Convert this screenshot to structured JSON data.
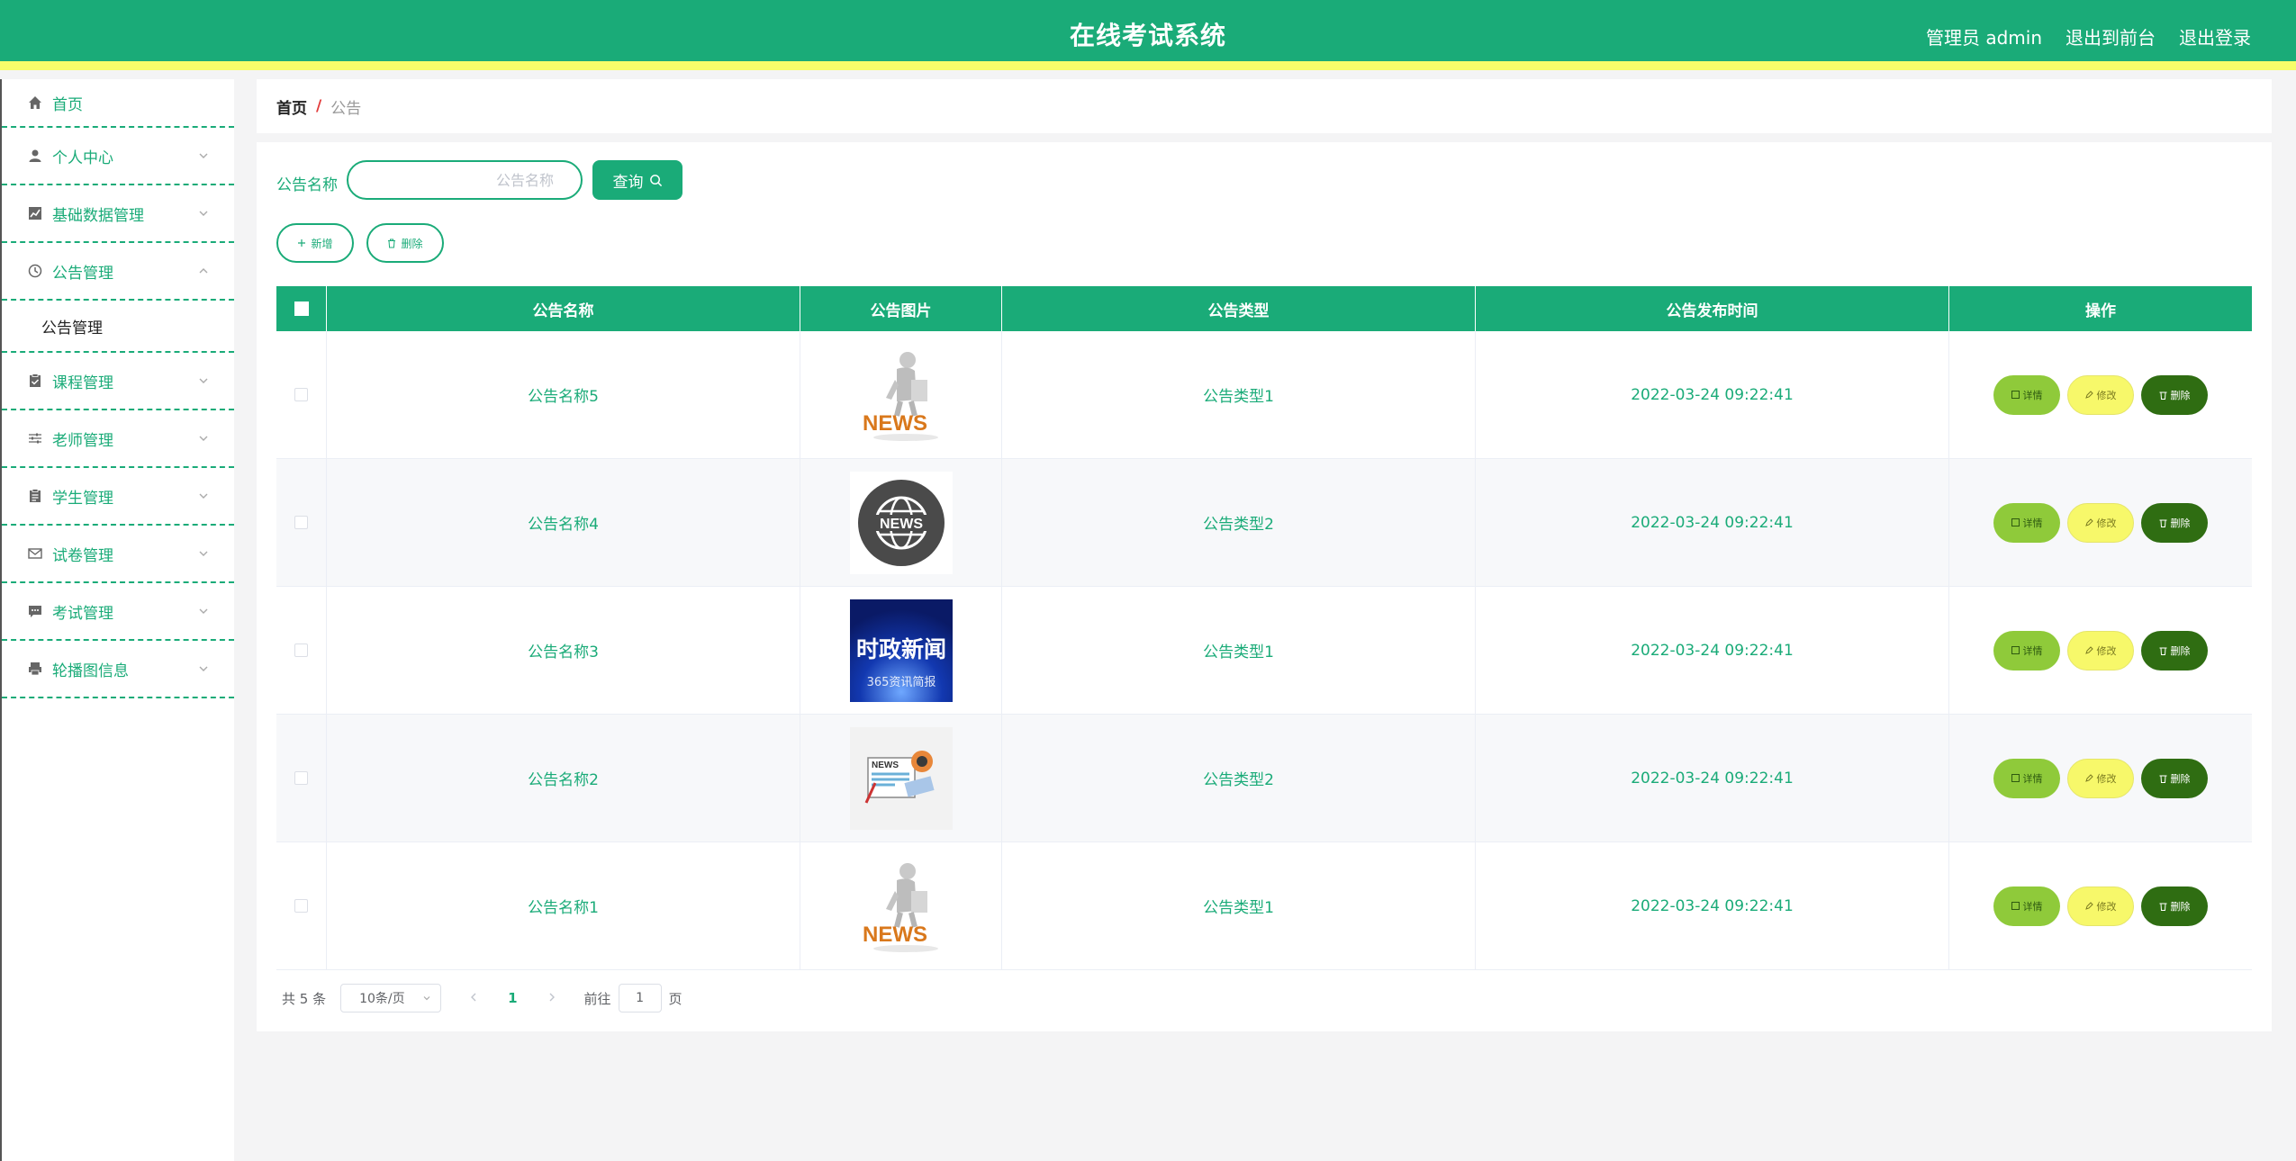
{
  "header": {
    "title": "在线考试系统",
    "admin": "管理员 admin",
    "to_front": "退出到前台",
    "logout": "退出登录"
  },
  "sidebar": {
    "items": [
      {
        "label": "首页",
        "icon": "home-icon"
      },
      {
        "label": "个人中心",
        "icon": "user-icon"
      },
      {
        "label": "基础数据管理",
        "icon": "chart-icon"
      },
      {
        "label": "公告管理",
        "icon": "clock-icon"
      },
      {
        "label": "课程管理",
        "icon": "clipboard-icon"
      },
      {
        "label": "老师管理",
        "icon": "sliders-icon"
      },
      {
        "label": "学生管理",
        "icon": "document-icon"
      },
      {
        "label": "试卷管理",
        "icon": "mail-icon"
      },
      {
        "label": "考试管理",
        "icon": "chat-icon"
      },
      {
        "label": "轮播图信息",
        "icon": "printer-icon"
      }
    ],
    "submenu": "公告管理"
  },
  "breadcrumb": {
    "home": "首页",
    "sep": "/",
    "current": "公告"
  },
  "search": {
    "label": "公告名称",
    "placeholder": "公告名称",
    "query": "查询"
  },
  "actions": {
    "add": "新增",
    "delete": "删除"
  },
  "table": {
    "headers": [
      "公告名称",
      "公告图片",
      "公告类型",
      "公告发布时间",
      "操作"
    ],
    "rows": [
      {
        "name": "公告名称5",
        "image": "news-figure",
        "type": "公告类型1",
        "time": "2022-03-24 09:22:41"
      },
      {
        "name": "公告名称4",
        "image": "news-globe",
        "type": "公告类型2",
        "time": "2022-03-24 09:22:41"
      },
      {
        "name": "公告名称3",
        "image": "political-news",
        "type": "公告类型1",
        "time": "2022-03-24 09:22:41"
      },
      {
        "name": "公告名称2",
        "image": "news-paper",
        "type": "公告类型2",
        "time": "2022-03-24 09:22:41"
      },
      {
        "name": "公告名称1",
        "image": "news-figure",
        "type": "公告类型1",
        "time": "2022-03-24 09:22:41"
      }
    ],
    "ops": {
      "detail": "详情",
      "edit": "修改",
      "delete": "删除"
    }
  },
  "thumbs": {
    "news_text": "NEWS",
    "political_title": "时政新闻",
    "political_sub": "365资讯简报"
  },
  "pagination": {
    "total": "共 5 条",
    "page_size": "10条/页",
    "current": "1",
    "goto_prefix": "前往",
    "goto_value": "1",
    "goto_suffix": "页"
  },
  "colors": {
    "primary": "#1aab78",
    "accent": "#f7fd6a",
    "detail": "#8fca3a",
    "edit": "#f7f86a",
    "delete": "#2f6d12"
  }
}
